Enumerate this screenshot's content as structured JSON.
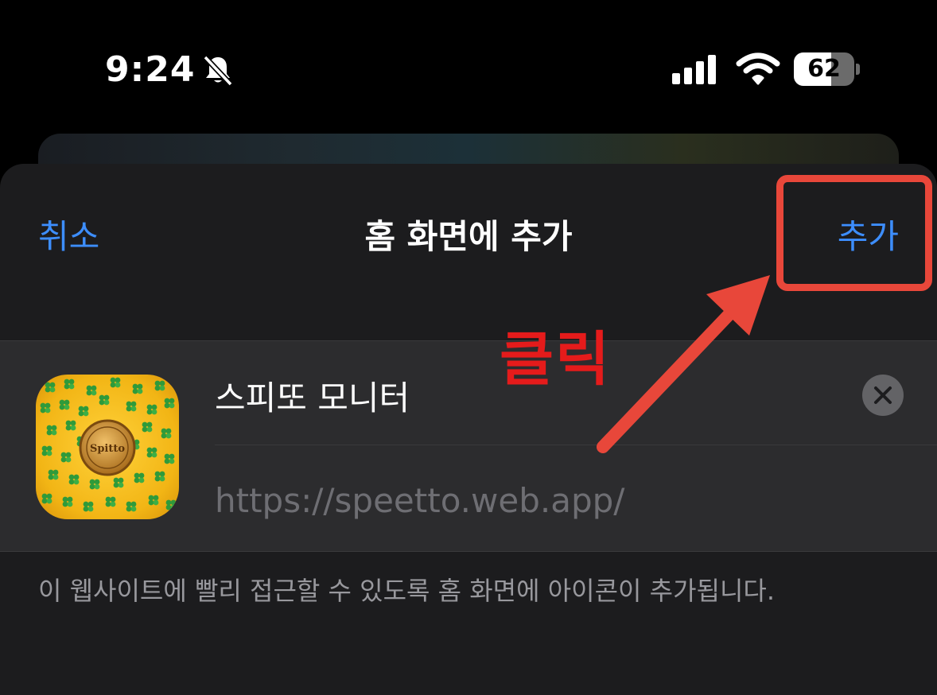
{
  "status_bar": {
    "time": "9:24",
    "silent_icon": "bell-slash-icon",
    "signal_icon": "cellular-signal-icon",
    "wifi_icon": "wifi-icon",
    "battery_level": "62",
    "battery_fraction": 0.62
  },
  "sheet": {
    "cancel_label": "취소",
    "title": "홈 화면에 추가",
    "add_label": "추가"
  },
  "shortcut": {
    "name": "스피또 모니터",
    "url": "https://speetto.web.app/",
    "icon": "speetto-app-icon",
    "coin_text": "Spitto"
  },
  "footer": {
    "note": "이 웹사이트에 빨리 접근할 수 있도록 홈 화면에 아이콘이 추가됩니다."
  },
  "annotation": {
    "label": "클릭",
    "color": "#e8473a"
  },
  "colors": {
    "accent": "#3d8eff",
    "sheet_bg": "#1c1c1e",
    "group_bg": "#2c2c2e",
    "annotation_red": "#e51b1b"
  }
}
